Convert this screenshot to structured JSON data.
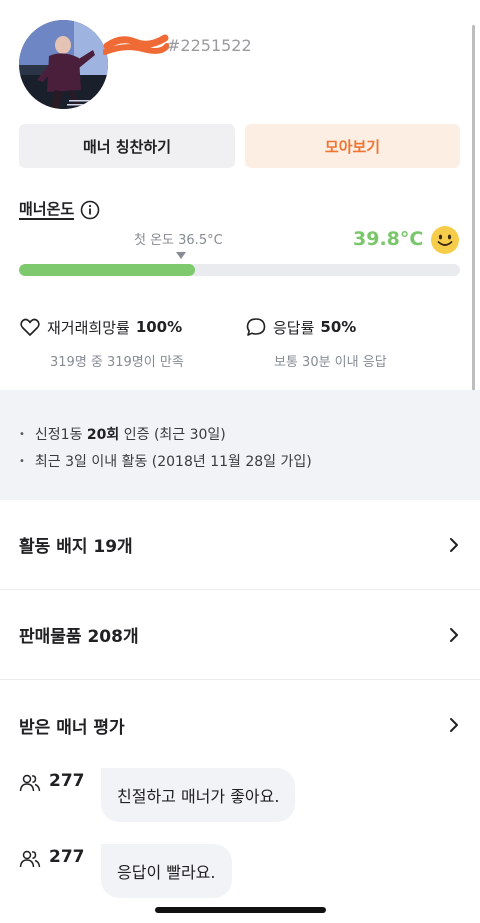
{
  "profile": {
    "user_id": "#2251522",
    "avatar_caption": "avatar"
  },
  "buttons": {
    "praise_label": "매너 칭찬하기",
    "collect_label": "모아보기"
  },
  "manner_temp": {
    "title": "매너온도",
    "first_temp_label": "첫 온도 36.5°C",
    "current_value": "39.8°C",
    "current_fraction": 0.398,
    "accent_color": "#7ac66b"
  },
  "stats": {
    "rehire_label": "재거래희망률",
    "rehire_value": "100%",
    "rehire_sub": "319명 중 319명이 만족",
    "response_label": "응답률",
    "response_value": "50%",
    "response_sub": "보통 30분 이내 응답"
  },
  "info": {
    "line1_prefix": "신정1동 ",
    "line1_bold": "20회",
    "line1_suffix": " 인증 (최근 30일)",
    "line2": "최근 3일 이내 활동 (2018년 11월 28일 가입)"
  },
  "sections": {
    "badges": "활동 배지 19개",
    "sales": "판매물품 208개",
    "manner_reviews": "받은 매너 평가"
  },
  "reviews": [
    {
      "count": "277",
      "text": "친절하고 매너가 좋아요."
    },
    {
      "count": "277",
      "text": "응답이 빨라요."
    }
  ]
}
